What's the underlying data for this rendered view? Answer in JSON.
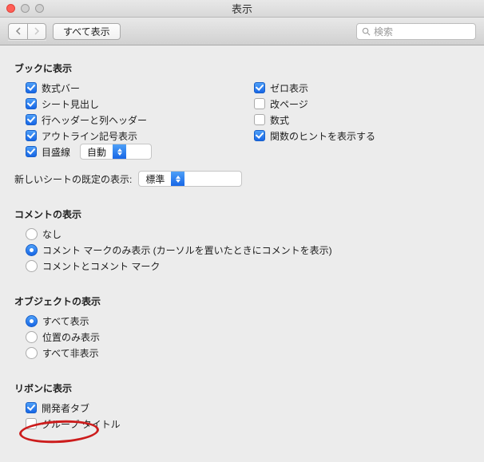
{
  "window": {
    "title": "表示"
  },
  "toolbar": {
    "show_all": "すべて表示",
    "search_placeholder": "検索"
  },
  "book": {
    "title": "ブックに表示",
    "formula_bar": "数式バー",
    "sheet_tabs": "シート見出し",
    "row_col_headers": "行ヘッダーと列ヘッダー",
    "outline_symbols": "アウトライン記号表示",
    "gridlines": "目盛線",
    "gridlines_select": "自動",
    "zero_values": "ゼロ表示",
    "page_breaks": "改ページ",
    "formulas": "数式",
    "function_tips": "関数のヒントを表示する"
  },
  "newsheet": {
    "label": "新しいシートの既定の表示:",
    "value": "標準"
  },
  "comments": {
    "title": "コメントの表示",
    "none": "なし",
    "marks_only": "コメント マークのみ表示 (カーソルを置いたときにコメントを表示)",
    "both": "コメントとコメント マーク"
  },
  "objects": {
    "title": "オブジェクトの表示",
    "all": "すべて表示",
    "placeholders": "位置のみ表示",
    "none": "すべて非表示"
  },
  "ribbon": {
    "title": "リボンに表示",
    "developer_tab": "開発者タブ",
    "group_titles": "グループ タイトル"
  }
}
